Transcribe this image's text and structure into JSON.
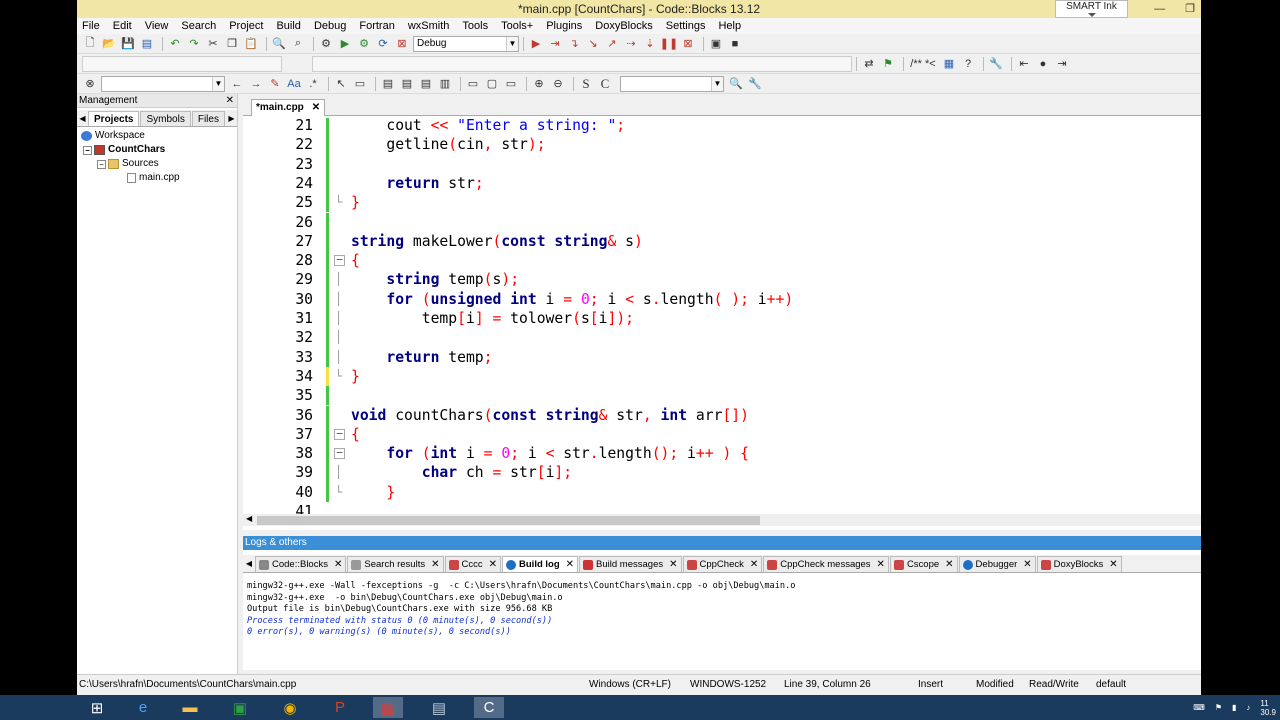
{
  "window": {
    "title": "*main.cpp [CountChars] - Code::Blocks 13.12"
  },
  "smart_ink": {
    "label": "SMART Ink"
  },
  "menu": [
    "File",
    "Edit",
    "View",
    "Search",
    "Project",
    "Build",
    "Debug",
    "Fortran",
    "wxSmith",
    "Tools",
    "Tools+",
    "Plugins",
    "DoxyBlocks",
    "Settings",
    "Help"
  ],
  "toolbar": {
    "build_target": "Debug",
    "doc_comment": "/** *<"
  },
  "management": {
    "title": "Management",
    "tabs": [
      "Projects",
      "Symbols",
      "Files"
    ],
    "tree": {
      "workspace": "Workspace",
      "project": "CountChars",
      "folder": "Sources",
      "file": "main.cpp"
    }
  },
  "editor": {
    "tab_label": "*main.cpp",
    "lines": [
      {
        "n": "21",
        "text": "    cout << \"Enter a string: \";"
      },
      {
        "n": "22",
        "text": "    getline(cin, str);"
      },
      {
        "n": "23",
        "text": ""
      },
      {
        "n": "24",
        "text": "    return str;"
      },
      {
        "n": "25",
        "text": "}"
      },
      {
        "n": "26",
        "text": ""
      },
      {
        "n": "27",
        "text": "string makeLower(const string& s)"
      },
      {
        "n": "28",
        "text": "{"
      },
      {
        "n": "29",
        "text": "    string temp(s);"
      },
      {
        "n": "30",
        "text": "    for (unsigned int i = 0; i < s.length( ); i++)"
      },
      {
        "n": "31",
        "text": "        temp[i] = tolower(s[i]);"
      },
      {
        "n": "32",
        "text": ""
      },
      {
        "n": "33",
        "text": "    return temp;"
      },
      {
        "n": "34",
        "text": "}"
      },
      {
        "n": "35",
        "text": ""
      },
      {
        "n": "36",
        "text": "void countChars(const string& str, int arr[])"
      },
      {
        "n": "37",
        "text": "{"
      },
      {
        "n": "38",
        "text": "    for (int i = 0; i < str.length(); i++ ) {"
      },
      {
        "n": "39",
        "text": "        char ch = str[i];"
      },
      {
        "n": "40",
        "text": "    }"
      },
      {
        "n": "41",
        "text": ""
      }
    ]
  },
  "logs": {
    "title": "Logs & others",
    "tabs": [
      "Code::Blocks",
      "Search results",
      "Cccc",
      "Build log",
      "Build messages",
      "CppCheck",
      "CppCheck messages",
      "Cscope",
      "Debugger",
      "DoxyBlocks"
    ],
    "active_tab": "Build log",
    "lines": [
      "mingw32-g++.exe -Wall -fexceptions -g  -c C:\\Users\\hrafn\\Documents\\CountChars\\main.cpp -o obj\\Debug\\main.o",
      "mingw32-g++.exe  -o bin\\Debug\\CountChars.exe obj\\Debug\\main.o",
      "Output file is bin\\Debug\\CountChars.exe with size 956.68 KB",
      "Process terminated with status 0 (0 minute(s), 0 second(s))",
      "0 error(s), 0 warning(s) (0 minute(s), 0 second(s))"
    ]
  },
  "status": {
    "path": "C:\\Users\\hrafn\\Documents\\CountChars\\main.cpp",
    "eol": "Windows (CR+LF)",
    "encoding": "WINDOWS-1252",
    "position": "Line 39, Column 26",
    "mode": "Insert",
    "modified": "Modified",
    "access": "Read/Write",
    "lang": "default"
  },
  "taskbar": {
    "clock_time": "11",
    "clock_date": "30.9"
  },
  "colors": {
    "title_bg": "#f2e6a6",
    "logs_head": "#3a8fd6",
    "keyword": "#000080",
    "string": "#0000ff",
    "number": "#ff00ff",
    "operator": "#ff0000",
    "change_bar_green": "#45c545",
    "change_bar_yellow": "#f5e23c"
  }
}
